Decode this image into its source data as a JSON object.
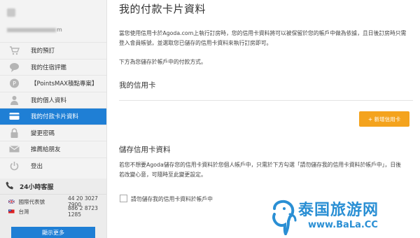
{
  "sidebar": {
    "email_suffix": "m",
    "items": [
      {
        "label": "我的預訂",
        "icon": "cart-icon",
        "name": "sidebar-item-bookings"
      },
      {
        "label": "我的住宿評鑑",
        "icon": "chat-bubble-icon",
        "name": "sidebar-item-reviews"
      },
      {
        "label": "【PointsMAX積點專案】",
        "icon": "points-icon",
        "name": "sidebar-item-pointsmax"
      },
      {
        "label": "我的個人資料",
        "icon": "user-icon",
        "name": "sidebar-item-profile"
      },
      {
        "label": "我的付款卡片資料",
        "icon": "card-icon",
        "name": "sidebar-item-payment",
        "active": true
      },
      {
        "label": "變更密碼",
        "icon": "lock-icon",
        "name": "sidebar-item-password"
      },
      {
        "label": "推薦給朋友",
        "icon": "envelope-icon",
        "name": "sidebar-item-refer"
      },
      {
        "label": "登出",
        "icon": "power-icon",
        "name": "sidebar-item-logout"
      }
    ]
  },
  "help": {
    "title": "24小時客服",
    "phones": [
      {
        "region": "國際代表號",
        "number": "44 20 3027 7900"
      },
      {
        "region": "台灣",
        "number": "886 2 8723 1285"
      }
    ],
    "more_label": "顯示更多"
  },
  "main": {
    "title": "我的付款卡片資料",
    "intro": "當您使用信用卡於Agoda.com上執行訂房時，您的信用卡資料將可以被保留於您的帳戶中做為依據，且日後訂房時只需登入會員帳號，並選取您已儲存的信用卡資料來執行訂房即可。",
    "stored_note": "下方為您儲存於帳戶中的付款方式。",
    "credit_title": "我的信用卡",
    "add_button": "+ 新增信用卡",
    "save_title": "儲存信用卡資料",
    "save_desc": "若您不想要Agoda儲存您的信用卡資料於您個人帳戶中，只需於下方勾選「請勿儲存我的信用卡資料於帳戶中」，日後若改變心意，可隨時至此變更設定。",
    "checkbox_label": "請勿儲存我的信用卡資料於帳戶中"
  },
  "watermark": {
    "cn": "泰国旅游网",
    "en": "www.BaLa.CC"
  },
  "colors": {
    "accent": "#1f7fd5",
    "button": "#f4a31d",
    "watermark": "#2a8fd4"
  }
}
